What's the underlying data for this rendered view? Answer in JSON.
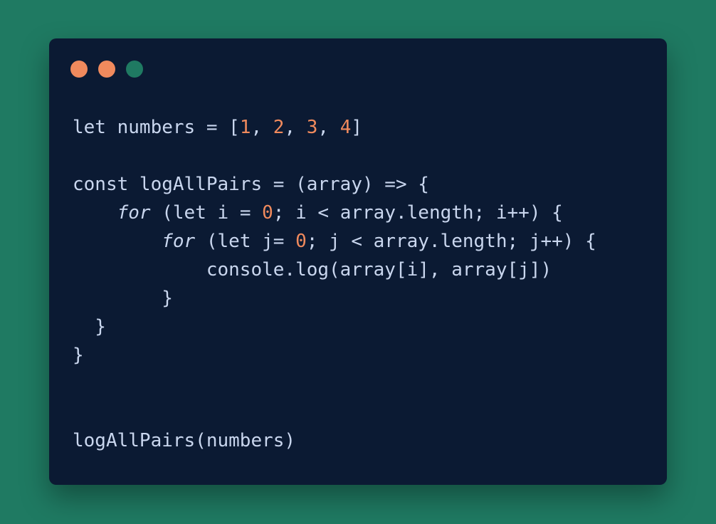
{
  "window": {
    "dots": [
      {
        "name": "close",
        "color": "#f08a5d"
      },
      {
        "name": "minimize",
        "color": "#f08a5d"
      },
      {
        "name": "maximize",
        "color": "#1f7a62"
      }
    ]
  },
  "code": {
    "lines": [
      [
        {
          "t": "let numbers = ["
        },
        {
          "t": "1",
          "c": "num"
        },
        {
          "t": ", "
        },
        {
          "t": "2",
          "c": "num"
        },
        {
          "t": ", "
        },
        {
          "t": "3",
          "c": "num"
        },
        {
          "t": ", "
        },
        {
          "t": "4",
          "c": "num"
        },
        {
          "t": "]"
        }
      ],
      [],
      [
        {
          "t": "const logAllPairs = (array) => {"
        }
      ],
      [
        {
          "t": "    "
        },
        {
          "t": "for",
          "c": "kw-italic"
        },
        {
          "t": " (let i = "
        },
        {
          "t": "0",
          "c": "num"
        },
        {
          "t": "; i < array.length; i++) {"
        }
      ],
      [
        {
          "t": "        "
        },
        {
          "t": "for",
          "c": "kw-italic"
        },
        {
          "t": " (let j= "
        },
        {
          "t": "0",
          "c": "num"
        },
        {
          "t": "; j < array.length; j++) {"
        }
      ],
      [
        {
          "t": "            console.log(array[i], array[j])"
        }
      ],
      [
        {
          "t": "        }"
        }
      ],
      [
        {
          "t": "  }"
        }
      ],
      [
        {
          "t": "}"
        }
      ],
      [],
      [],
      [
        {
          "t": "logAllPairs(numbers)"
        }
      ]
    ]
  }
}
